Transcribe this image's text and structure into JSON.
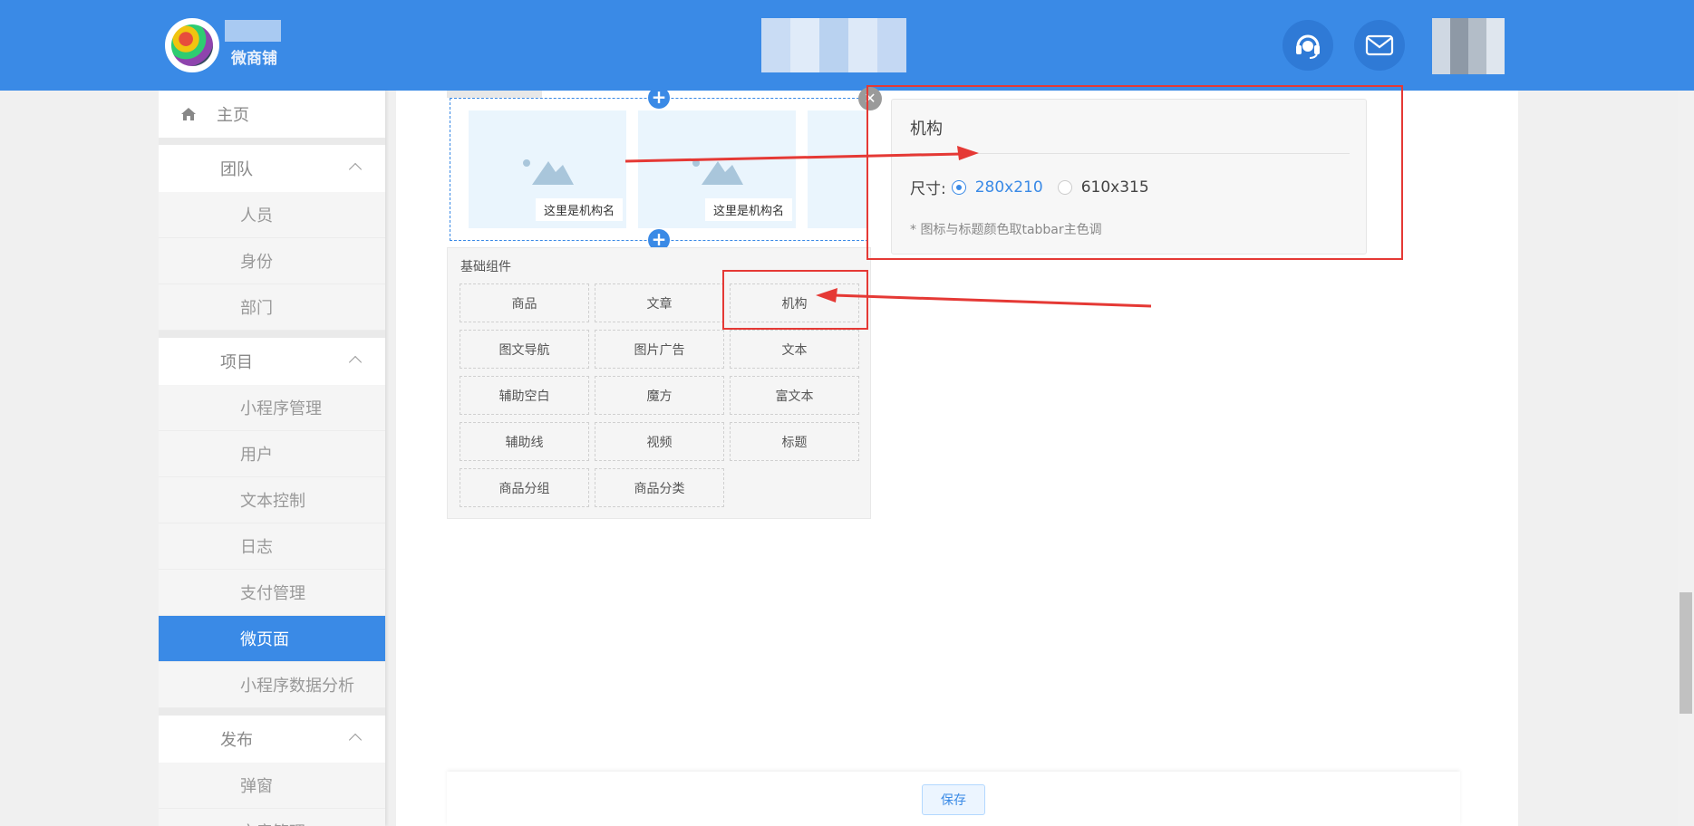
{
  "header": {
    "brand": "微商铺"
  },
  "sidebar": {
    "home_label": "主页",
    "groups": [
      {
        "label": "团队",
        "items": [
          "人员",
          "身份",
          "部门"
        ]
      },
      {
        "label": "项目",
        "items": [
          "小程序管理",
          "用户",
          "文本控制",
          "日志",
          "支付管理",
          "微页面",
          "小程序数据分析"
        ]
      },
      {
        "label": "发布",
        "items": [
          "弹窗",
          "文章管理"
        ]
      }
    ],
    "active_item": "微页面"
  },
  "preview": {
    "card_label": "这里是机构名"
  },
  "components": {
    "title": "基础组件",
    "items": [
      "商品",
      "文章",
      "机构",
      "图文导航",
      "图片广告",
      "文本",
      "辅助空白",
      "魔方",
      "富文本",
      "辅助线",
      "视频",
      "标题",
      "商品分组",
      "商品分类"
    ],
    "highlighted": "机构"
  },
  "settings": {
    "title": "机构",
    "size_label": "尺寸:",
    "size_options": [
      "280x210",
      "610x315"
    ],
    "selected_size": "280x210",
    "note": "* 图标与标题颜色取tabbar主色调"
  },
  "footer": {
    "save_label": "保存"
  },
  "colors": {
    "primary": "#3a8ae6",
    "annotation": "#e53935"
  }
}
